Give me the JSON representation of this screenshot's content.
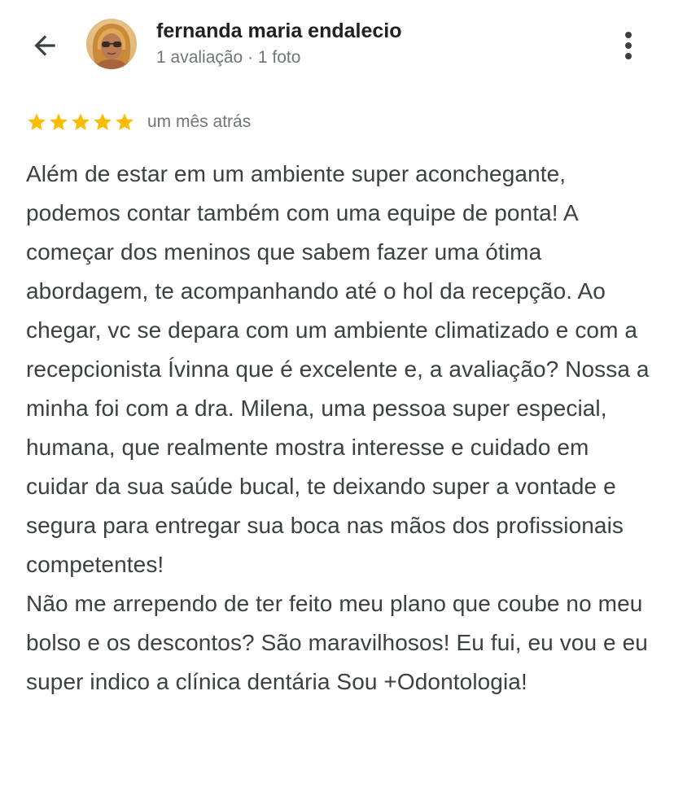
{
  "header": {
    "back_icon": "arrow-back-icon",
    "user_name": "fernanda maria endalecio",
    "user_meta": "1 avaliação · 1 foto",
    "more_icon": "more-vertical-icon"
  },
  "review": {
    "rating": 5,
    "max_rating": 5,
    "star_color": "#fbbc04",
    "time": "um mês atrás",
    "text": "Além de estar em um ambiente super aconchegante, podemos contar também com uma equipe de ponta! A começar dos meninos que sabem fazer uma ótima abordagem, te acompanhando até o hol da recepção. Ao chegar, vc se depara com um ambiente climatizado e com a recepcionista Ívinna que é excelente e, a avaliação? Nossa a minha foi com a dra. Milena, uma pessoa super especial, humana, que realmente mostra interesse e cuidado em cuidar da sua saúde bucal, te deixando super a vontade e segura para entregar sua boca nas mãos dos profissionais competentes!\nNão me arrependo de ter feito meu plano que coube no meu bolso e os descontos? São maravilhosos! Eu fui, eu vou e eu super indico a clínica dentária Sou +Odontologia!"
  }
}
